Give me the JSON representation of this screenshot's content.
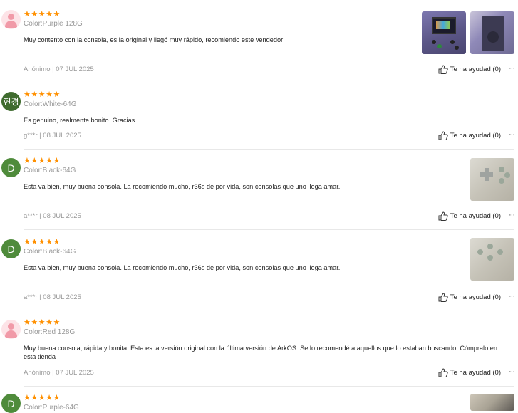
{
  "reviews": [
    {
      "avatar_type": "default",
      "stars": "★★★★★",
      "color": "Color:Purple 128G",
      "text": "Muy contento con la consola, es la original y llegó muy rápido, recomiendo este vendedor",
      "meta": "Anónimo | 07 JUL 2025",
      "helpful": "Te ha ayudad (0)",
      "more": "···"
    },
    {
      "avatar_type": "initial",
      "avatar_initial": "현경",
      "stars": "★★★★★",
      "color": "Color:White-64G",
      "text": "Es genuino, realmente bonito. Gracias.",
      "meta": "g***r | 08 JUL 2025",
      "helpful": "Te ha ayudad (0)",
      "more": "···"
    },
    {
      "avatar_type": "initial",
      "avatar_initial": "D",
      "stars": "★★★★★",
      "color": "Color:Black-64G",
      "text": "Esta va bien, muy buena consola. La recomiendo mucho, r36s de por vida, son consolas que uno llega amar.",
      "meta": "a***r | 08 JUL 2025",
      "helpful": "Te ha ayudad (0)",
      "more": "···"
    },
    {
      "avatar_type": "initial",
      "avatar_initial": "D",
      "stars": "★★★★★",
      "color": "Color:Black-64G",
      "text": "Esta va bien, muy buena consola. La recomiendo mucho, r36s de por vida, son consolas que uno llega amar.",
      "meta": "a***r | 08 JUL 2025",
      "helpful": "Te ha ayudad (0)",
      "more": "···"
    },
    {
      "avatar_type": "default",
      "stars": "★★★★★",
      "color": "Color:Red 128G",
      "text": "Muy buena consola, rápida y bonita. Esta es la versión original con la última versión de ArkOS. Se lo recomendé a aquellos que lo estaban buscando. Cómpralo en esta tienda",
      "meta": "Anónimo | 07 JUL 2025",
      "helpful": "Te ha ayudad (0)",
      "more": "···"
    },
    {
      "avatar_type": "initial",
      "avatar_initial": "D",
      "stars": "★★★★★",
      "color": "Color:Purple-64G"
    }
  ],
  "colors": {
    "star": "#ff9000",
    "avatar_green": "#4f8b3b",
    "avatar_pink_bg": "#fde3e7",
    "muted_text": "#999999"
  },
  "icons": {
    "helpful": "thumbs-up-icon",
    "more": "more-options-icon",
    "default_avatar": "user-icon"
  }
}
